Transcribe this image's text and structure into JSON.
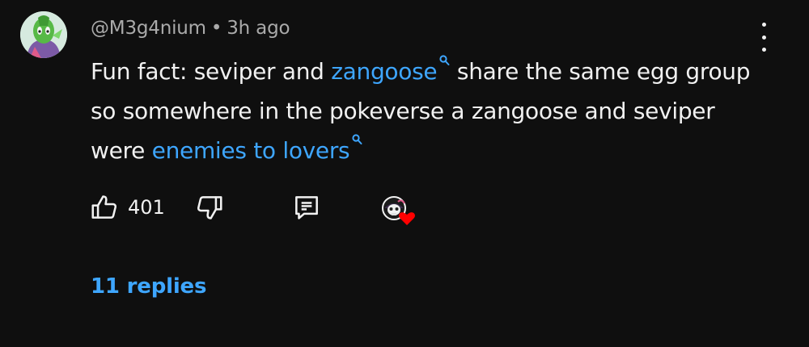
{
  "comment": {
    "author": "@M3g4nium",
    "separator": "•",
    "time": "3h ago",
    "text_part1": "Fun fact: seviper and ",
    "link1": "zangoose",
    "text_part2": " share the same egg group so somewhere in the pokeverse a zangoose and seviper were ",
    "link2": "enemies to lovers"
  },
  "actions": {
    "like_count": "401"
  },
  "replies_label": "11 replies",
  "colors": {
    "background": "#0f0f0f",
    "text": "#f1f1f1",
    "secondary_text": "#aaaaaa",
    "link": "#3ea6ff",
    "heart": "#ff0000"
  },
  "icons": [
    "avatar",
    "more-vert-icon",
    "search-icon",
    "like-icon",
    "dislike-icon",
    "reply-icon",
    "creator-heart-icon"
  ]
}
